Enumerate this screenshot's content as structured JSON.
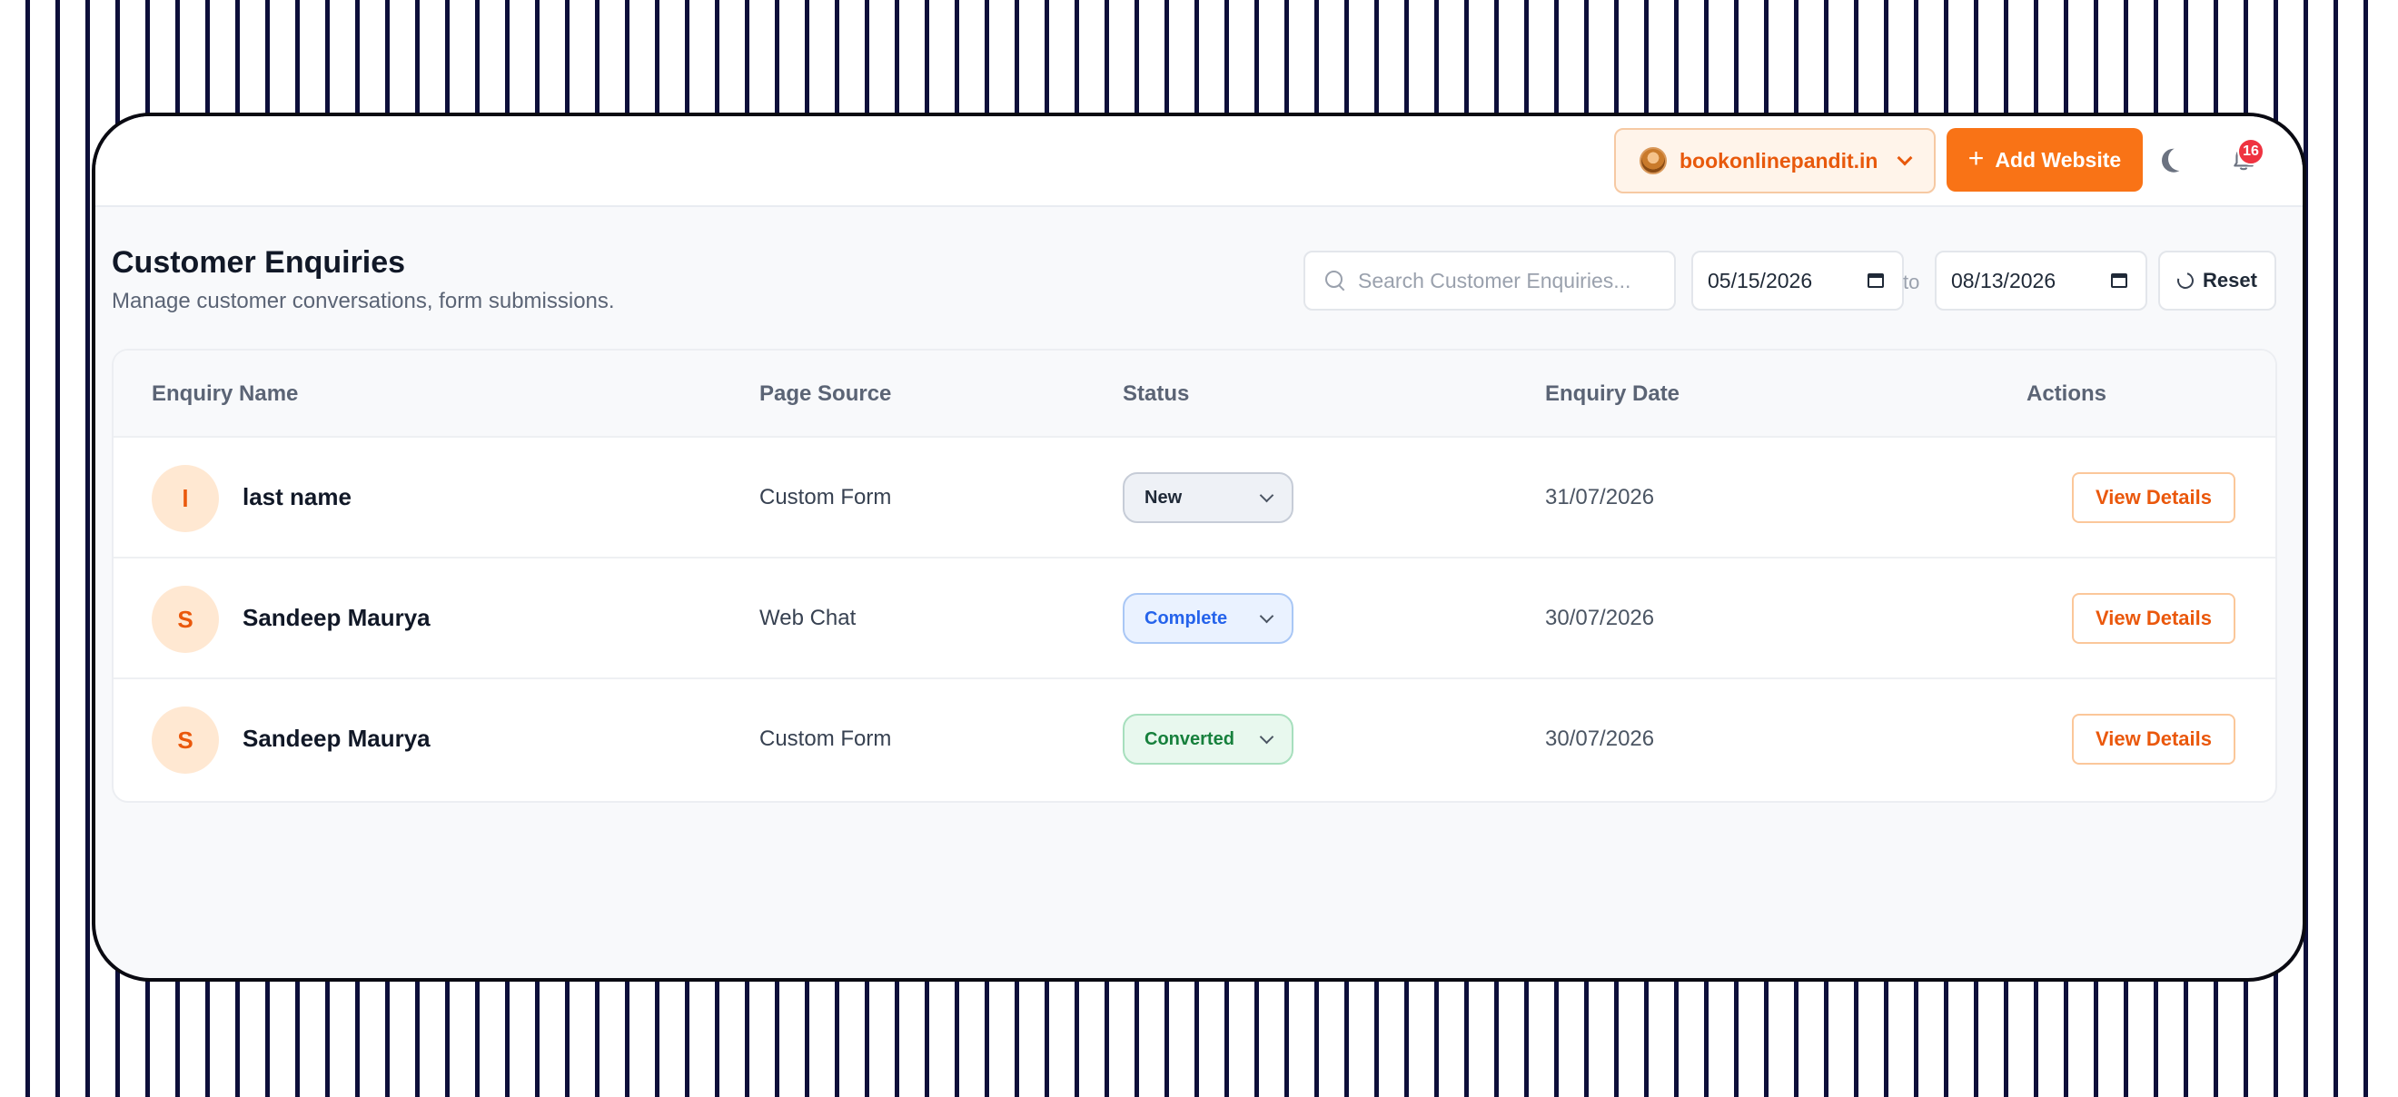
{
  "header": {
    "site_selector": "bookonlinepandit.in",
    "add_website_label": "Add Website",
    "notification_count": "16"
  },
  "page": {
    "title": "Customer Enquiries",
    "subtitle": "Manage customer conversations, form submissions."
  },
  "filters": {
    "search_placeholder": "Search Customer Enquiries...",
    "date_from": "05/15/2026",
    "to_label": "to",
    "date_to": "08/13/2026",
    "reset_label": "Reset"
  },
  "table": {
    "columns": [
      "Enquiry Name",
      "Page Source",
      "Status",
      "Enquiry Date",
      "Actions"
    ],
    "rows": [
      {
        "initial": "l",
        "name": "last name",
        "source": "Custom Form",
        "status": "New",
        "date": "31/07/2026",
        "action": "View Details"
      },
      {
        "initial": "S",
        "name": "Sandeep Maurya",
        "source": "Web Chat",
        "status": "Complete",
        "date": "30/07/2026",
        "action": "View Details"
      },
      {
        "initial": "S",
        "name": "Sandeep Maurya",
        "source": "Custom Form",
        "status": "Converted",
        "date": "30/07/2026",
        "action": "View Details"
      }
    ]
  },
  "colors": {
    "accent": "#f97316",
    "status_new": "#1f2937",
    "status_complete": "#2563eb",
    "status_converted": "#16803c"
  },
  "icons": [
    "search-icon",
    "calendar-icon",
    "reset-icon",
    "moon-icon",
    "bell-icon",
    "chevron-down-icon",
    "plus-icon"
  ]
}
